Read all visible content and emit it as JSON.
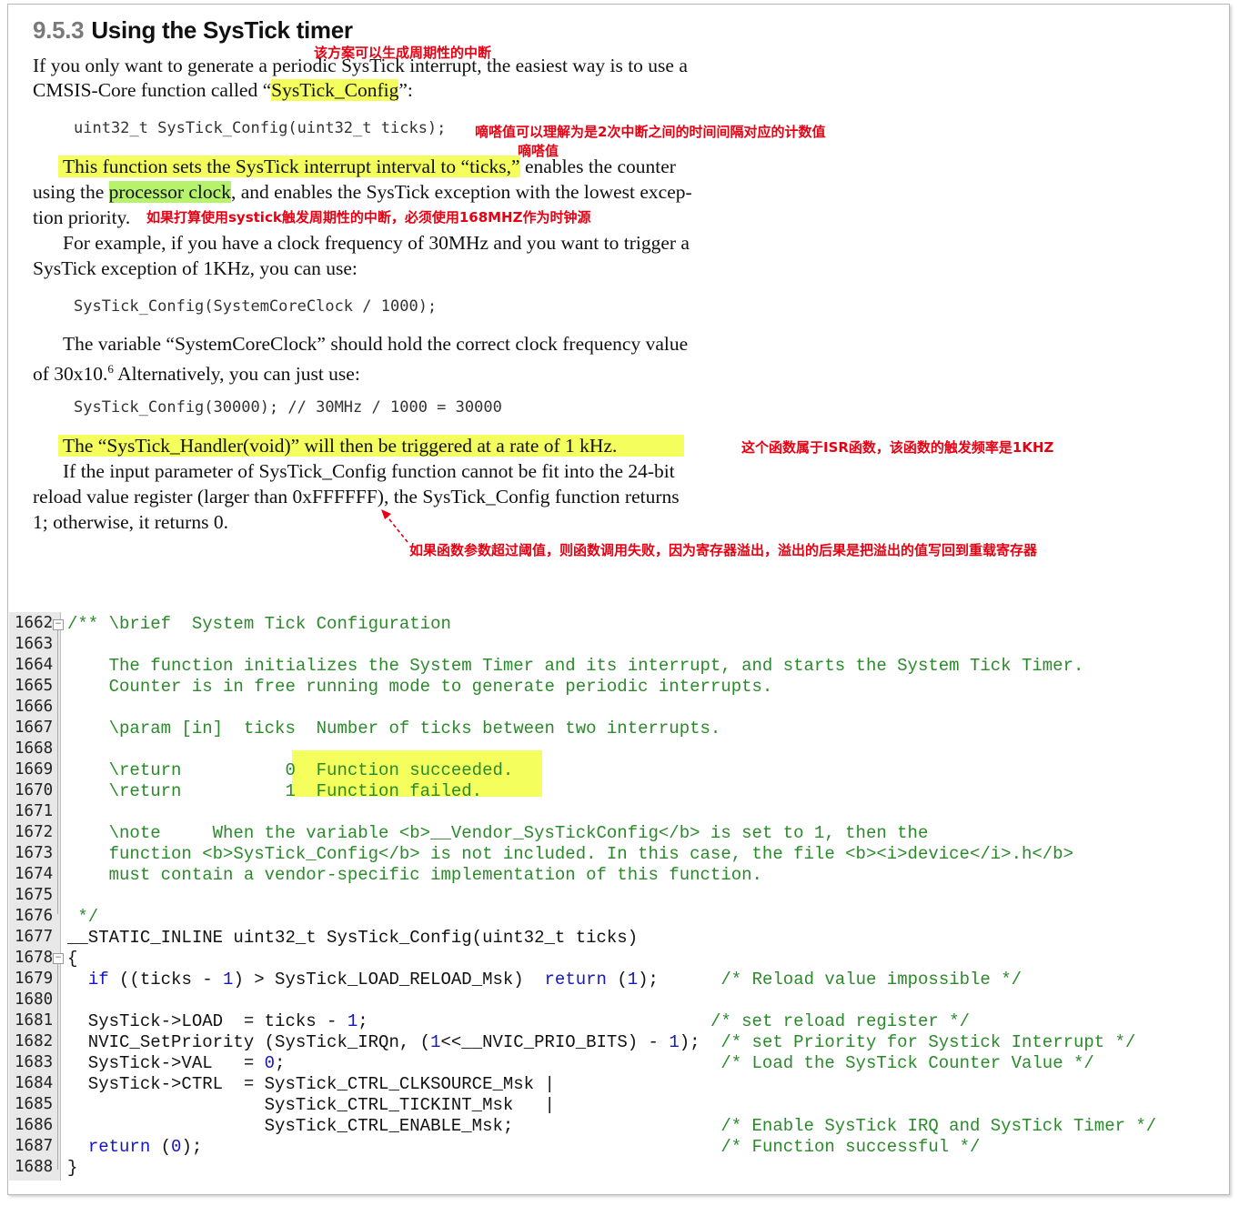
{
  "heading": {
    "number": "9.5.3",
    "title": "Using the SysTick timer"
  },
  "annotations": {
    "periodic": "该方案可以生成周期性的中断",
    "ticks_meaning": "嘀嗒值可以理解为是2次中断之间的时间间隔对应的计数值",
    "ticks_label": "嘀嗒值",
    "clock_source": "如果打算使用systick触发周期性的中断，必须使用168MHZ作为时钟源",
    "isr_rate": "这个函数属于ISR函数，该函数的触发频率是1KHZ",
    "overflow": "如果函数参数超过阈值，则函数调用失败，因为寄存器溢出，溢出的后果是把溢出的值写回到重载寄存器"
  },
  "para1": {
    "l1a": "If you only want to generate a periodic SysTick interrupt, the easiest way is to use a",
    "l2a": "CMSIS-Core function called “",
    "l2hl": "SysTick_Config",
    "l2b": "”:"
  },
  "code1": "uint32_t SysTick_Config(uint32_t ticks);",
  "para2": {
    "l1hl": "This function sets the SysTick interrupt interval to “ticks,”",
    "l1b": " enables the counter",
    "l2a": "using the ",
    "l2hl": "processor clock",
    "l2b": ", and enables the SysTick exception with the lowest excep-",
    "l3": "tion priority."
  },
  "para3": {
    "l1": "For example, if you have a clock frequency of 30MHz and you want to trigger a",
    "l2": "SysTick exception of 1KHz, you can use:"
  },
  "code2": "SysTick_Config(SystemCoreClock / 1000);",
  "para4": {
    "l1": "The variable “SystemCoreClock” should hold the correct clock frequency value",
    "l2a": "of 30x10.",
    "l2sup": "6",
    "l2b": " Alternatively, you can just use:"
  },
  "code3": "SysTick_Config(30000); // 30MHz / 1000 = 30000",
  "para5": {
    "hl": "The “SysTick_Handler(void)” will then be triggered at a rate of 1 kHz."
  },
  "para6": {
    "l1": "If the input parameter of SysTick_Config function cannot be fit into the 24-bit",
    "l2": "reload value register (larger than 0xFFFFFF), the SysTick_Config function returns",
    "l3": "1; otherwise, it returns 0."
  },
  "listing": {
    "line_numbers": [
      "1662",
      "1663",
      "1664",
      "1665",
      "1666",
      "1667",
      "1668",
      "1669",
      "1670",
      "1671",
      "1672",
      "1673",
      "1674",
      "1675",
      "1676",
      "1677",
      "1678",
      "1679",
      "1680",
      "1681",
      "1682",
      "1683",
      "1684",
      "1685",
      "1686",
      "1687",
      "1688"
    ],
    "c1662": "/** \\brief  System Tick Configuration",
    "c1664": "    The function initializes the System Timer and its interrupt, and starts the System Tick Timer.",
    "c1665": "    Counter is in free running mode to generate periodic interrupts.",
    "c1667": "    \\param [in]  ticks  Number of ticks between two interrupts.",
    "c1669": "    \\return          0  Function succeeded.",
    "c1670": "    \\return          1  Function failed.",
    "c1672": "    \\note     When the variable <b>__Vendor_SysTickConfig</b> is set to 1, then the",
    "c1673": "    function <b>SysTick_Config</b> is not included. In this case, the file <b><i>device</i>.h</b>",
    "c1674": "    must contain a vendor-specific implementation of this function.",
    "c1676": " */",
    "c1677": "__STATIC_INLINE uint32_t SysTick_Config(uint32_t ticks)",
    "c1678": "{",
    "c1679_kw": "if",
    "c1679a": " ((ticks - ",
    "c1679n1": "1",
    "c1679b": ") > SysTick_LOAD_RELOAD_Msk)  ",
    "c1679kw2": "return",
    "c1679c": " (",
    "c1679n2": "1",
    "c1679d": ");      ",
    "c1679cmt": "/* Reload value impossible */",
    "c1681a": "  SysTick->LOAD  = ticks - ",
    "c1681n": "1",
    "c1681b": ";                                 ",
    "c1681cmt": "/* set reload register */",
    "c1682a": "  NVIC_SetPriority (SysTick_IRQn, (",
    "c1682n1": "1",
    "c1682b": "<<__NVIC_PRIO_BITS) - ",
    "c1682n2": "1",
    "c1682c": ");  ",
    "c1682cmt": "/* set Priority for Systick Interrupt */",
    "c1683a": "  SysTick->VAL   = ",
    "c1683n": "0",
    "c1683b": ";                                          ",
    "c1683cmt": "/* Load the SysTick Counter Value */",
    "c1684": "  SysTick->CTRL  = SysTick_CTRL_CLKSOURCE_Msk |",
    "c1685": "                   SysTick_CTRL_TICKINT_Msk   |",
    "c1686a": "                   SysTick_CTRL_ENABLE_Msk;                    ",
    "c1686cmt": "/* Enable SysTick IRQ and SysTick Timer */",
    "c1687kw": "return",
    "c1687a": " (",
    "c1687n": "0",
    "c1687b": ");                                                  ",
    "c1687cmt": "/* Function successful */",
    "c1688": "}"
  },
  "colors": {
    "annotation": "#e60012",
    "highlight_yellow": "#f4ff5e",
    "highlight_green": "#b6f26b",
    "comment": "#2a8a2a",
    "keyword": "#1515c4"
  }
}
